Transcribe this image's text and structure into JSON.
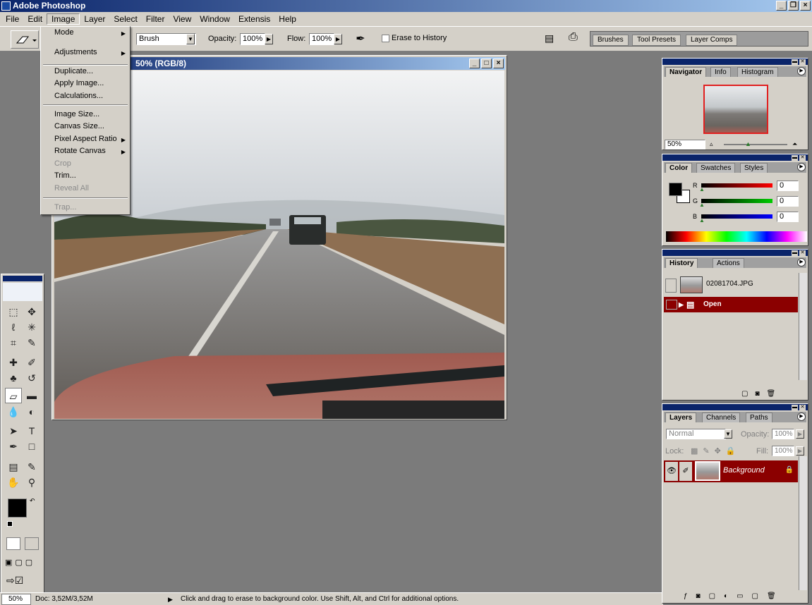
{
  "app": {
    "title": "Adobe Photoshop"
  },
  "menubar": [
    "File",
    "Edit",
    "Image",
    "Layer",
    "Select",
    "Filter",
    "View",
    "Window",
    "Extensis",
    "Help"
  ],
  "options": {
    "brush_mode": "Brush",
    "opacity_label": "Opacity:",
    "opacity_value": "100%",
    "flow_label": "Flow:",
    "flow_value": "100%",
    "erase_history": "Erase to History",
    "well_tabs": [
      "Brushes",
      "Tool Presets",
      "Layer Comps"
    ]
  },
  "image_menu": {
    "items": [
      {
        "label": "Mode",
        "submenu": true
      },
      {
        "label": "Adjustments",
        "submenu": true
      },
      {
        "label": "Duplicate..."
      },
      {
        "label": "Apply Image..."
      },
      {
        "label": "Calculations..."
      },
      {
        "label": "Image Size..."
      },
      {
        "label": "Canvas Size..."
      },
      {
        "label": "Pixel Aspect Ratio",
        "submenu": true
      },
      {
        "label": "Rotate Canvas",
        "submenu": true
      },
      {
        "label": "Crop",
        "disabled": true
      },
      {
        "label": "Trim..."
      },
      {
        "label": "Reveal All",
        "disabled": true
      },
      {
        "label": "Trap...",
        "disabled": true
      }
    ]
  },
  "document": {
    "title": "50% (RGB/8)"
  },
  "navigator": {
    "tabs": [
      "Navigator",
      "Info",
      "Histogram"
    ],
    "zoom": "50%"
  },
  "color": {
    "tabs": [
      "Color",
      "Swatches",
      "Styles"
    ],
    "r": "0",
    "g": "0",
    "b": "0",
    "r_label": "R",
    "g_label": "G",
    "b_label": "B"
  },
  "history": {
    "tabs": [
      "History",
      "Actions"
    ],
    "snapshot": "02081704.JPG",
    "step": "Open"
  },
  "layers": {
    "tabs": [
      "Layers",
      "Channels",
      "Paths"
    ],
    "blend": "Normal",
    "opacity_label": "Opacity:",
    "opacity": "100%",
    "lock_label": "Lock:",
    "fill_label": "Fill:",
    "fill": "100%",
    "layer_name": "Background"
  },
  "status": {
    "zoom": "50%",
    "doc": "Doc: 3,52M/3,52M",
    "hint": "Click and drag to erase to background color.  Use Shift, Alt, and Ctrl for additional options."
  }
}
